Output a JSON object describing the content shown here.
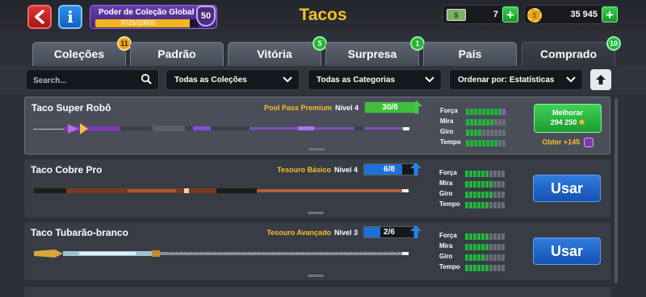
{
  "header": {
    "back_icon": "back-arrow-icon",
    "info_icon": "info-icon",
    "power_title": "Poder de Coleção Global",
    "power_progress": "9725/10600",
    "power_fraction": 0.917,
    "power_level": "50",
    "title": "Tacos",
    "cash_value": "7",
    "coin_value": "35 945"
  },
  "tabs": [
    {
      "label": "Coleções",
      "badge": "11",
      "badge_color": "#e8a21c"
    },
    {
      "label": "Padrão",
      "badge": ""
    },
    {
      "label": "Vitória",
      "badge": "5",
      "badge_color": "#24b53a"
    },
    {
      "label": "Surpresa",
      "badge": "1",
      "badge_color": "#24b53a"
    },
    {
      "label": "País",
      "badge": ""
    },
    {
      "label": "Comprado",
      "badge": "10",
      "badge_color": "#24b53a",
      "active": true
    }
  ],
  "filters": {
    "search_placeholder": "Search...",
    "collection_dropdown": "Todas as Coleções",
    "category_dropdown": "Todas as Categorias",
    "sort_dropdown": "Ordenar por: Estatísticas"
  },
  "stat_labels": [
    "Força",
    "Mira",
    "Giro",
    "Tempo"
  ],
  "cues": [
    {
      "name": "Taco Super Robô",
      "source": "Pool Pass Premium",
      "level_label": "Nível 4",
      "level_progress": "30/8",
      "level_fraction": 1.0,
      "bar_color": "#3fbf3a",
      "arrow_color": "green",
      "stats": {
        "Força": 9,
        "Mira": 7,
        "Giro": 4,
        "Tempo": 8
      },
      "stats_extended": {
        "Força": 2,
        "Mira": 0,
        "Giro": 0,
        "Tempo": 0
      },
      "stats_max": 10,
      "upgrade_label": "Melhorar",
      "upgrade_cost": "294 250",
      "reward": "Obter +145"
    },
    {
      "name": "Taco Cobre Pro",
      "source": "Tesouro Básico",
      "level_label": "Nível 4",
      "level_progress": "6/8",
      "level_fraction": 0.75,
      "bar_color": "#1f6fd8",
      "arrow_color": "blue",
      "stats": {
        "Força": 6,
        "Mira": 7,
        "Giro": 7,
        "Tempo": 6
      },
      "stats_max": 10,
      "button_label": "Usar"
    },
    {
      "name": "Taco Tubarão-branco",
      "source": "Tesouro Avançado",
      "level_label": "Nível 3",
      "level_progress": "2/6",
      "level_fraction": 0.33,
      "bar_color": "#1f6fd8",
      "arrow_color": "blue",
      "stats": {
        "Força": 6,
        "Mira": 6,
        "Giro": 5,
        "Tempo": 6
      },
      "stats_max": 10,
      "button_label": "Usar"
    }
  ]
}
